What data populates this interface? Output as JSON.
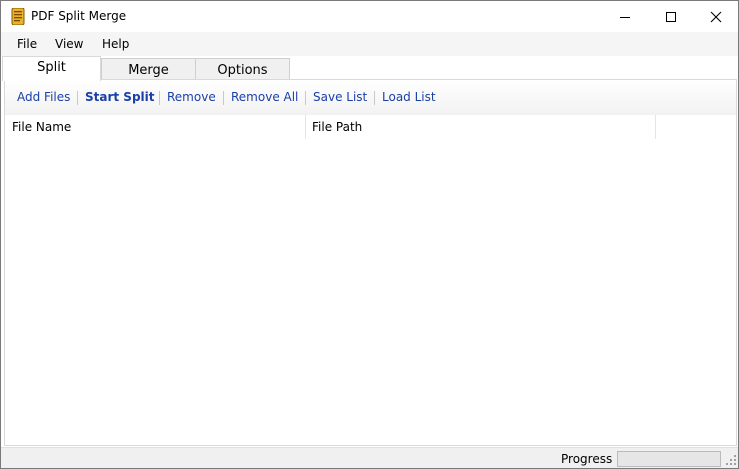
{
  "window": {
    "title": "PDF Split Merge"
  },
  "menu": {
    "items": [
      "File",
      "View",
      "Help"
    ]
  },
  "tabs": [
    "Split",
    "Merge",
    "Options"
  ],
  "active_tab": "Split",
  "toolbar": {
    "add_files": "Add Files",
    "start_split": "Start Split",
    "remove": "Remove",
    "remove_all": "Remove All",
    "save_list": "Save List",
    "load_list": "Load List"
  },
  "list": {
    "columns": [
      "File Name",
      "File Path"
    ],
    "rows": []
  },
  "status": {
    "progress_label": "Progress",
    "progress_value": 0
  },
  "colors": {
    "link": "#1a3fa8",
    "progress_fill": "#06b025"
  }
}
